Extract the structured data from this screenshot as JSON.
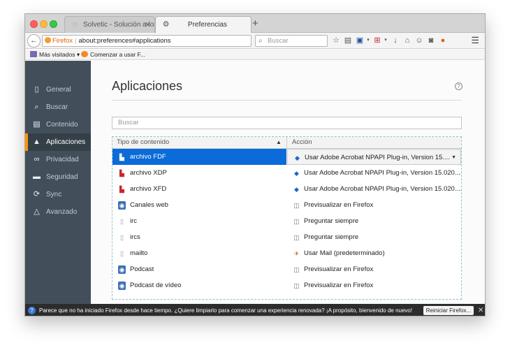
{
  "tabs": [
    {
      "label": "Solvetic - Solución a los pr...",
      "icon": "solvetic-icon"
    },
    {
      "label": "Preferencias",
      "icon": "gear-icon"
    }
  ],
  "navbar": {
    "url_badge": "Firefox",
    "url": "about:preferences#applications",
    "search_placeholder": "Buscar"
  },
  "bookmarks": [
    {
      "label": "Más visitados ▾"
    },
    {
      "label": "Comenzar a usar F..."
    }
  ],
  "sidebar": {
    "items": [
      {
        "label": "General",
        "icon": "general-icon"
      },
      {
        "label": "Buscar",
        "icon": "search-icon"
      },
      {
        "label": "Contenido",
        "icon": "content-icon"
      },
      {
        "label": "Aplicaciones",
        "icon": "rocket-icon",
        "active": true
      },
      {
        "label": "Privacidad",
        "icon": "mask-icon"
      },
      {
        "label": "Seguridad",
        "icon": "lock-icon"
      },
      {
        "label": "Sync",
        "icon": "sync-icon"
      },
      {
        "label": "Avanzado",
        "icon": "wizard-hat-icon"
      }
    ]
  },
  "main": {
    "title": "Aplicaciones",
    "filter_placeholder": "Buscar",
    "columns": [
      "Tipo de contenido",
      "Acción"
    ],
    "rows": [
      {
        "type": "archivo FDF",
        "action": "Usar Adobe Acrobat NPAPI Plug-in, Version 15...."
      },
      {
        "type": "archivo XDP",
        "action": "Usar Adobe Acrobat NPAPI Plug-in, Version 15.020...."
      },
      {
        "type": "archivo XFD",
        "action": "Usar Adobe Acrobat NPAPI Plug-in, Version 15.020...."
      },
      {
        "type": "Canales web",
        "action": "Previsualizar en Firefox"
      },
      {
        "type": "irc",
        "action": "Preguntar siempre"
      },
      {
        "type": "ircs",
        "action": "Preguntar siempre"
      },
      {
        "type": "mailto",
        "action": "Usar Mail (predeterminado)"
      },
      {
        "type": "Podcast",
        "action": "Previsualizar en Firefox"
      },
      {
        "type": "Podcast de vídeo",
        "action": "Previsualizar en Firefox"
      }
    ]
  },
  "notification": {
    "text": "Parece que no ha iniciado Firefox desde hace tiempo. ¿Quiere limpiarlo para comenzar una experiencia renovada? ¡A propósito, bienvenido de nuevo!",
    "button": "Reiniciar Firefox..."
  },
  "colors": {
    "sidebar_bg": "#424f5a",
    "sidebar_active_bg": "#343f48",
    "active_accent": "#ff9500",
    "selection": "#0b6bd8"
  }
}
